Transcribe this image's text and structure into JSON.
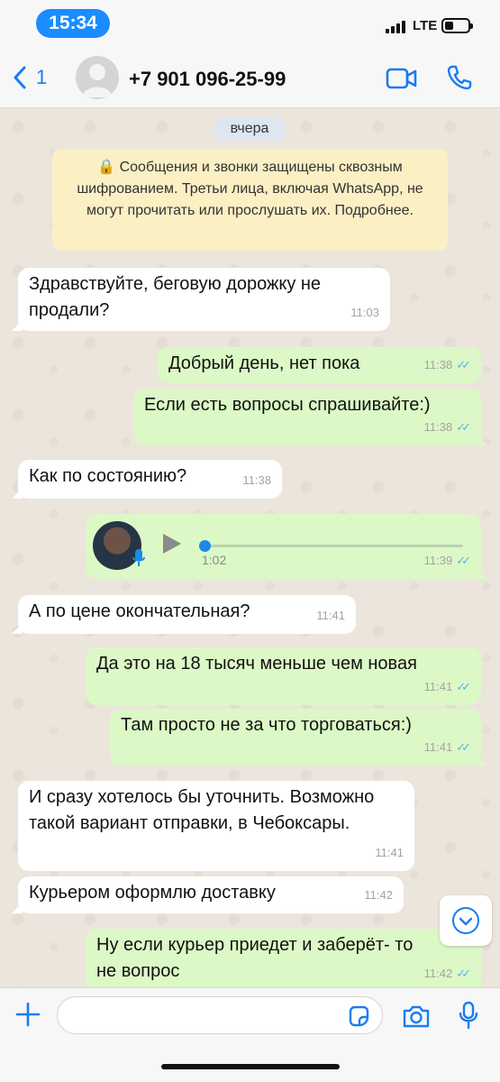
{
  "status_bar": {
    "time": "15:34",
    "network": "LTE",
    "battery": "low"
  },
  "header": {
    "back_label": "1",
    "contact_name": "+7 901 096-25-99",
    "icons": [
      "back-chevron",
      "contact-avatar",
      "video-call",
      "voice-call"
    ]
  },
  "chat": {
    "date_separator": "вчера",
    "encryption_notice": "🔒 Сообщения и звонки защищены сквозным шифрованием. Третьи лица, включая WhatsApp, не могут прочитать или прослушать их. Подробнее.",
    "messages": [
      {
        "direction": "in",
        "text": "Здравствуйте, беговую дорожку не продали?",
        "time": "11:03"
      },
      {
        "direction": "out",
        "text": "Добрый день, нет пока",
        "time": "11:38",
        "status": "read"
      },
      {
        "direction": "out",
        "text": "Если есть вопросы спрашивайте:)",
        "time": "11:38",
        "status": "read"
      },
      {
        "direction": "in",
        "text": "Как по состоянию?",
        "time": "11:38"
      },
      {
        "direction": "out",
        "type": "voice",
        "duration": "1:02",
        "time": "11:39",
        "status": "read"
      },
      {
        "direction": "in",
        "text": "А по цене окончательная?",
        "time": "11:41"
      },
      {
        "direction": "out",
        "text": "Да это на 18 тысяч меньше чем новая",
        "time": "11:41",
        "status": "read"
      },
      {
        "direction": "out",
        "text": "Там просто не за что торговаться:)",
        "time": "11:41",
        "status": "read"
      },
      {
        "direction": "in",
        "text": "И сразу хотелось бы уточнить. Возможно такой вариант отправки, в Чебоксары.",
        "time": "11:41"
      },
      {
        "direction": "in",
        "text": "Курьером оформлю доставку",
        "time": "11:42"
      },
      {
        "direction": "out",
        "text": "Ну если курьер приедет и заберёт- то не вопрос",
        "time": "11:42",
        "status": "read"
      }
    ]
  },
  "input_bar": {
    "placeholder": "",
    "icons": [
      "plus",
      "sticker",
      "camera",
      "microphone"
    ]
  },
  "colors": {
    "accent": "#1a7cf2",
    "outgoing_bubble": "#dcf8c6",
    "incoming_bubble": "#ffffff",
    "read_ticks": "#4fb6ec",
    "notice_bg": "#fbefc4"
  }
}
